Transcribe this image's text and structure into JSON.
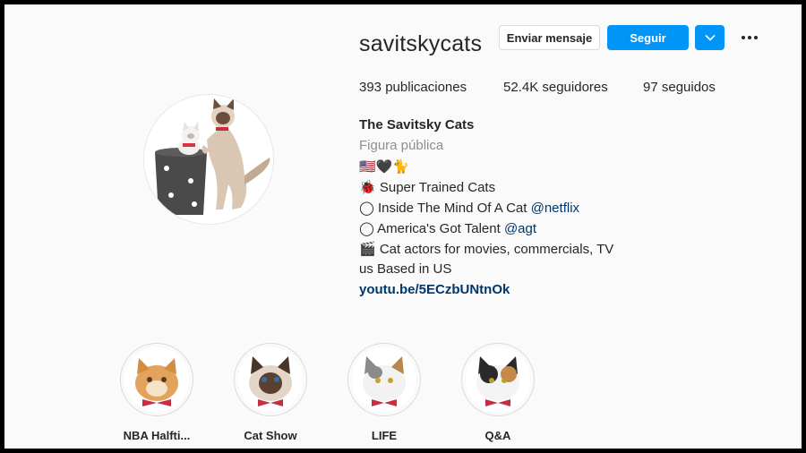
{
  "profile": {
    "username": "savitskycats",
    "buttons": {
      "message": "Enviar mensaje",
      "follow": "Seguir"
    },
    "stats": {
      "posts_count": "393",
      "posts_label": "publicaciones",
      "followers_count": "52.4K",
      "followers_label": "seguidores",
      "following_count": "97",
      "following_label": "seguidos"
    },
    "bio": {
      "name": "The Savitsky Cats",
      "category": "Figura pública",
      "line1": "🇺🇸🖤🐈",
      "line2": "🐞 Super Trained Cats",
      "line3_text": "◯ Inside The Mind Of A Cat ",
      "line3_link": "@netflix",
      "line4_text": "◯ America's Got Talent ",
      "line4_link": "@agt",
      "line5": "🎬 Cat actors for movies, commercials, TV",
      "line6": "us Based in US",
      "website": "youtu.be/5ECzbUNtnOk"
    }
  },
  "highlights": [
    {
      "label": "NBA Halfti..."
    },
    {
      "label": "Cat Show"
    },
    {
      "label": "LIFE"
    },
    {
      "label": "Q&A"
    }
  ],
  "colors": {
    "accent": "#0095f6",
    "link": "#00376b",
    "muted": "#8e8e8e",
    "text": "#262626",
    "background": "#fafafa"
  }
}
